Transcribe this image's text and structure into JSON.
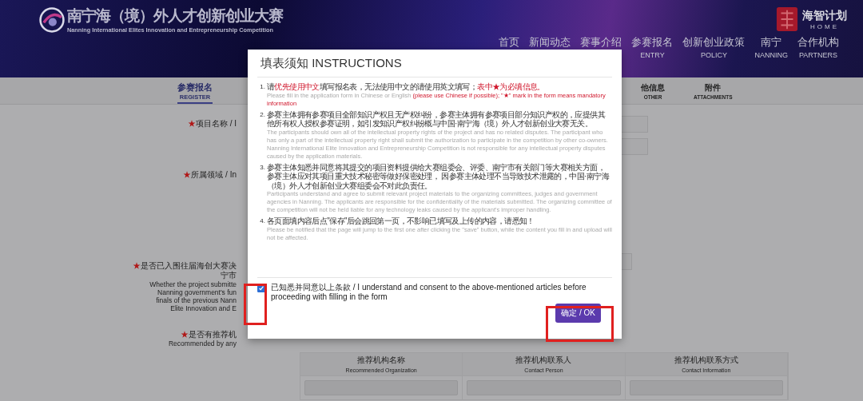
{
  "header": {
    "logo_title": "南宁海（境）外人才创新创业大赛",
    "logo_subtitle": "Nanning International Elites Innovation and Entrepreneurship Competition",
    "brand_title": "海智计划",
    "brand_subtitle": "HOME"
  },
  "nav": [
    {
      "cn": "首页"
    },
    {
      "cn": "新闻动态"
    },
    {
      "cn": "赛事介绍"
    },
    {
      "cn": "参赛报名",
      "en": "ENTRY"
    },
    {
      "cn": "创新创业政策",
      "en": "POLICY"
    },
    {
      "cn": "南宁",
      "en": "NANNING"
    },
    {
      "cn": "合作机构",
      "en": "PARTNERS"
    }
  ],
  "steps": [
    {
      "cn": "参赛报名",
      "en": "REGISTER",
      "selected": true
    },
    {
      "cn": "他信息",
      "en": "OTHER",
      "selected": false
    },
    {
      "cn": "附件",
      "en": "ATTACHMENTS",
      "selected": false
    }
  ],
  "form_rows": [
    {
      "marker": "★",
      "lines": [
        "项目名称 / I"
      ],
      "fields": [
        {
          "kind": "input"
        },
        {
          "kind": "input"
        }
      ]
    },
    {
      "marker": "★",
      "lines": [
        "所属领域 / In"
      ],
      "fields": []
    },
    {
      "marker": "★",
      "lines": [
        "是否已入围往届海创大赛决",
        "宁市",
        "Whether the project submitte",
        "Nanning government's fun",
        "finals of the previous Nann",
        "Elite Innovation and E"
      ],
      "fields": [
        {
          "kind": "input"
        }
      ]
    },
    {
      "marker": "★",
      "lines": [
        "是否有推荐机",
        "Recommended by any"
      ],
      "fields": []
    }
  ],
  "recommend_table": {
    "columns": [
      {
        "cn": "推荐机构名称",
        "en": "Recommended Organization"
      },
      {
        "cn": "推荐机构联系人",
        "en": "Contact Person"
      },
      {
        "cn": "推荐机构联系方式",
        "en": "Contact Information"
      }
    ]
  },
  "modal": {
    "title": "填表须知 INSTRUCTIONS",
    "items": [
      {
        "number": "1.",
        "cn": [
          {
            "text": "请",
            "highlight": false
          },
          {
            "text": "优先使用中文",
            "highlight": true
          },
          {
            "text": "填写报名表，无法使用中文的请使用英文填写；",
            "highlight": false
          },
          {
            "text": "表中★为必填信息。",
            "highlight": true
          }
        ],
        "en": [
          {
            "text": "Please fill in the application form in Chinese or English ",
            "highlight": false
          },
          {
            "text": "(please use Chinese if possible); \"★\" mark in the form means mandatory information",
            "highlight": true
          }
        ]
      },
      {
        "number": "2.",
        "cn": [
          {
            "text": "参赛主体拥有参赛项目全部知识产权且无产权纠纷，参赛主体拥有参赛项目部分知识产权的，应提供其他所有权人授权参赛证明，如引发知识产权纠纷概与中国·南宁海（境）外人才创新创业大赛无关。",
            "highlight": false
          }
        ],
        "en": [
          {
            "text": "The participants should own all of the intellectual property rights of the project and has no related disputes. The participant who has only a part of the intellectual property right shall submit the authorization to participate in the competition by other co-owners. Nanning International Elite Innovation and Entrepreneurship Competition is not responsible for any intellectual property disputes caused by the application materials.",
            "highlight": false
          }
        ]
      },
      {
        "number": "3.",
        "cn": [
          {
            "text": "参赛主体知悉并同意将其提交的项目资料提供给大赛组委会、评委、南宁市有关部门等大赛相关方面，参赛主体应对其项目重大技术秘密等做好保密处理， 因参赛主体处理不当导致技术泄露的，中国·南宁海（境）外人才创新创业大赛组委会不对此负责任。",
            "highlight": false
          }
        ],
        "en": [
          {
            "text": "Participants understand and agree to submit relevant project materials to the organizing committees, judges and government agencies in Nanning. The applicants are responsible for the confidentiality of the materials submitted. The organizing committee of the competition will not be held liable for any technology leaks caused by the applicant's improper handling.",
            "highlight": false
          }
        ]
      },
      {
        "number": "4.",
        "cn": [
          {
            "text": "各页面填内容后点\"保存\"后会跳回第一页，不影响已填写及上传的内容，请悉知！",
            "highlight": false
          }
        ],
        "en": [
          {
            "text": "Please be notified that the page will jump to the first one after clicking the \"save\" button, while the content you fill in and upload will not be affected.",
            "highlight": false
          }
        ]
      }
    ],
    "consent": {
      "checked": true,
      "label": "已知悉并同意以上条款 / I understand and consent to the above-mentioned articles before proceeding with filling in the form"
    },
    "ok_button": "确定 / OK"
  },
  "annotations": [
    {
      "kind": "highlight-box"
    },
    {
      "kind": "highlight-box"
    }
  ]
}
